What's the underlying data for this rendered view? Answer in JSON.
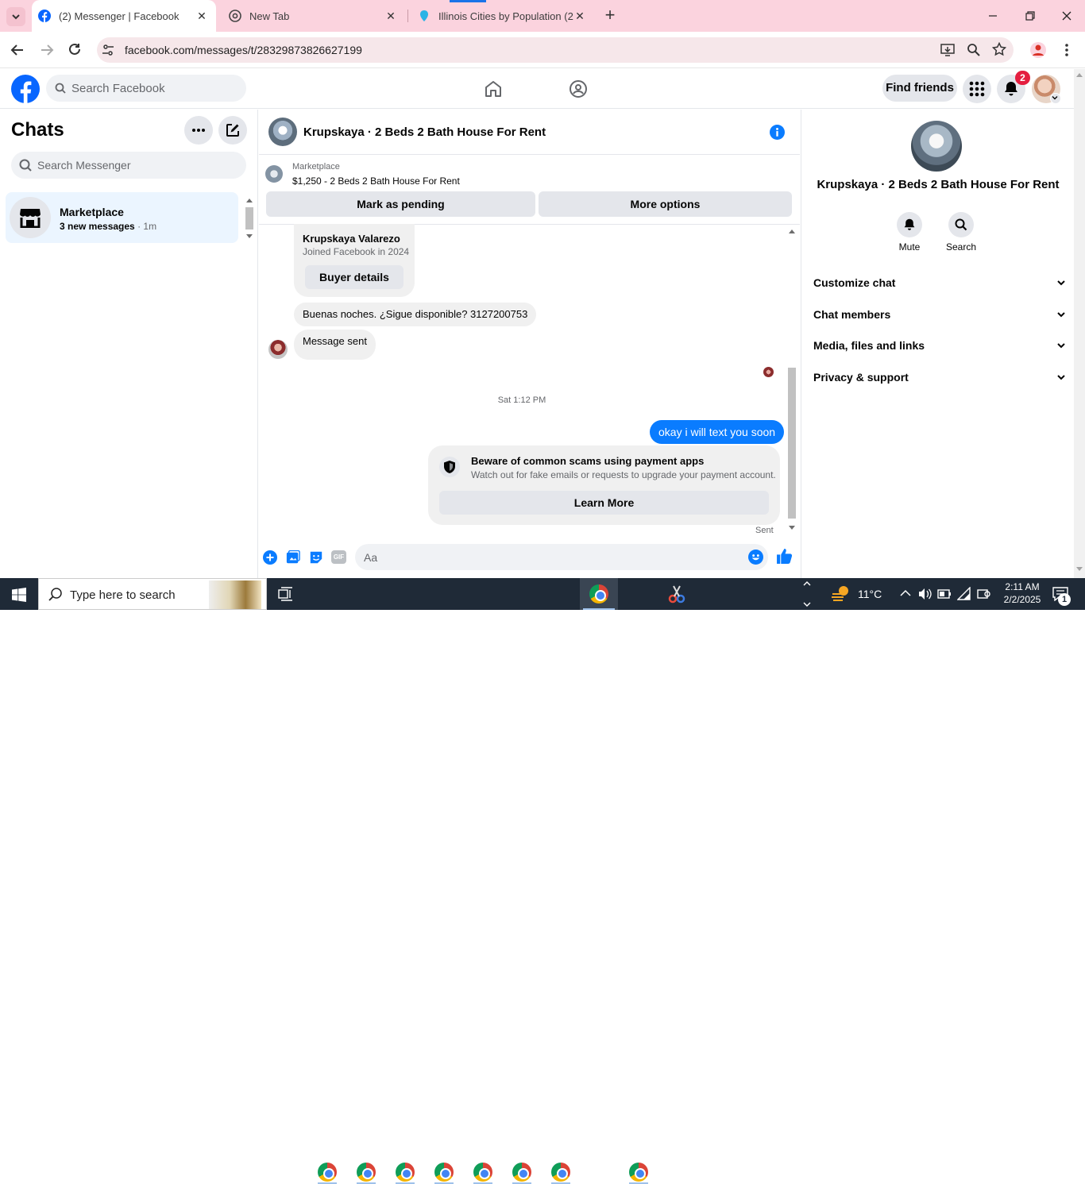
{
  "browser": {
    "tabs": [
      {
        "title": "(2) Messenger | Facebook",
        "icon": "facebook-icon",
        "active": true
      },
      {
        "title": "New Tab",
        "icon": "chrome-icon",
        "active": false
      },
      {
        "title": "Illinois Cities by Population (202",
        "icon": "map-pin-icon",
        "active": false
      }
    ],
    "url": "facebook.com/messages/t/28329873826627199"
  },
  "fb_header": {
    "search_placeholder": "Search Facebook",
    "find_friends": "Find friends",
    "notification_count": "2"
  },
  "chats": {
    "title": "Chats",
    "search_placeholder": "Search Messenger",
    "items": [
      {
        "name": "Marketplace",
        "preview": "3 new messages",
        "time": "1m"
      }
    ]
  },
  "conversation": {
    "title": "Krupskaya · 2 Beds 2 Bath House For Rent",
    "listing": {
      "label": "Marketplace",
      "detail": "$1,250 - 2 Beds 2 Bath House For Rent"
    },
    "actions": {
      "pending": "Mark as pending",
      "more": "More options"
    },
    "buyer_card": {
      "name": "Krupskaya Valarezo",
      "joined": "Joined Facebook in 2024",
      "button": "Buyer details"
    },
    "messages": [
      {
        "text": "Buenas noches. ¿Sigue disponible? 3127200753"
      },
      {
        "text": "Message sent"
      }
    ],
    "timestamp": "Sat 1:12 PM",
    "outgoing": "okay i will text you soon",
    "scam_notice": {
      "title": "Beware of common scams using payment apps",
      "body": "Watch out for fake emails or requests to upgrade your payment account.",
      "button": "Learn More"
    },
    "sent_status": "Sent",
    "composer_placeholder": "Aa"
  },
  "details": {
    "title": "Krupskaya · 2 Beds 2 Bath House For Rent",
    "mute": "Mute",
    "search": "Search",
    "sections": [
      "Customize chat",
      "Chat members",
      "Media, files and links",
      "Privacy & support"
    ]
  },
  "taskbar": {
    "search_placeholder": "Type here to search",
    "weather": "11°C",
    "time": "2:11 AM",
    "date": "2/2/2025",
    "notification_count": "1"
  },
  "colors": {
    "fb_blue": "#0866ff",
    "messenger_blue": "#0a7cff",
    "chrome_pink": "#fbd3de",
    "taskbar": "#1f2a37"
  }
}
